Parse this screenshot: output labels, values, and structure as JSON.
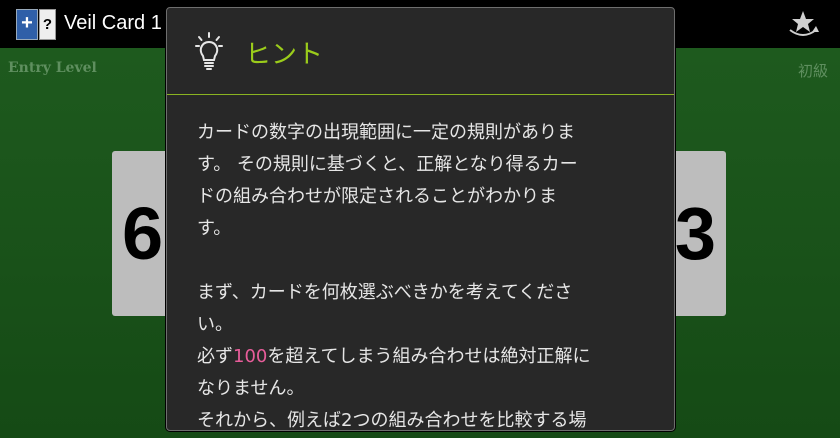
{
  "app": {
    "title": "Veil Card 1",
    "icon_a": "+",
    "icon_b": "?",
    "action_icon": "star-refresh-icon"
  },
  "game": {
    "level_en": "Entry Level",
    "level_jp": "初級",
    "card_left": "6",
    "card_right": "3"
  },
  "dialog": {
    "icon": "lightbulb-icon",
    "title": "ヒント",
    "accent_color": "#9bcc1b",
    "highlight_color": "#e85d9a",
    "lines": {
      "l1": "カードの数字の出現範囲に一定の規則がありま",
      "l2": "す。 その規則に基づくと、正解となり得るカー",
      "l3": "ドの組み合わせが限定されることがわかりま",
      "l4": "す。",
      "l5": "まず、カードを何枚選ぶべきかを考えてくださ",
      "l6": "い。",
      "l7_pre": "必ず",
      "l7_num": "100",
      "l7_post": "を超えてしまう組み合わせは絶対正解に",
      "l8": "なりません。",
      "l9": "それから、例えば2つの組み合わせを比較する場"
    }
  }
}
